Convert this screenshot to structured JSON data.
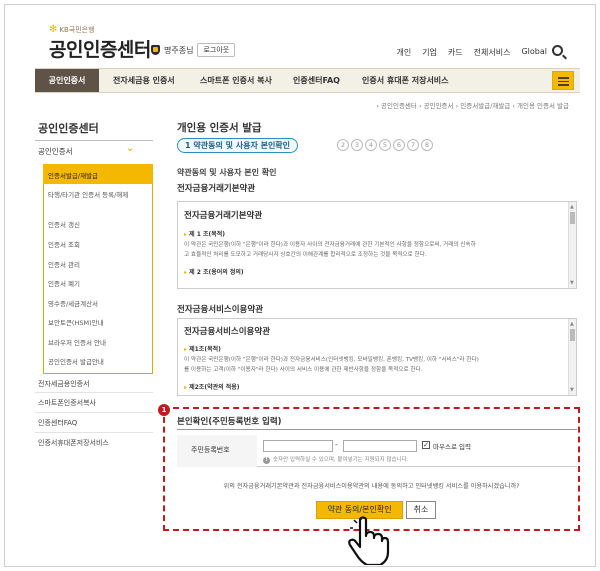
{
  "header": {
    "bank_name": "KB국민은행",
    "title": "공인인증센터",
    "user_name": "명주종님",
    "logout_label": "로그아웃",
    "nav": [
      "개인",
      "기업",
      "카드",
      "전체서비스",
      "Global"
    ]
  },
  "gnb": {
    "items": [
      "공인인증서",
      "전자세금용 인증서",
      "스마트폰 인증서 복사",
      "인증센터FAQ",
      "인증서 휴대폰 저장서비스"
    ],
    "active": "공인인증서"
  },
  "breadcrumb": "› 공인인증센터 › 공인인증서 › 인증서발급/재발급 › 개인용 인증서 발급",
  "sidebar": {
    "title": "공인인증센터",
    "header": "공인인증서",
    "subitems": [
      "인증서발급/재발급",
      "타행/타기관 인증서 등록/해제",
      "인증서 갱신",
      "인증서 조회",
      "인증서 관리",
      "인증서 폐기",
      "영수증/세금계산서",
      "보안토큰(HSM)안내",
      "브라우저 인증서 안내",
      "공인인증서 발급안내"
    ],
    "menus": [
      "전자세금용인증서",
      "스마트폰인증서복사",
      "인증센터FAQ",
      "인증서휴대폰저장서비스"
    ]
  },
  "main": {
    "title": "개인용 인증서 발급",
    "step_current": "1 약관동의 및 사용자 본인확인",
    "steps": [
      "2",
      "3",
      "4",
      "5",
      "6",
      "7",
      "8"
    ],
    "section_heading": "약관동의 및 사용자 본인 확인",
    "terms1": {
      "heading": "전자금융거래기본약관",
      "box_title": "전자금융거래기본약관",
      "article1": "제 1 조(목적)",
      "text1a": "이 약관은 국민은행(이하 \"은행\"이라 한다)과 이용자 사이의 전자금융거래에 관한 기본적인 사항을 정함으로써, 거래의 신속하",
      "text1b": "고 효율적인 처리를 도모하고 거래당사자 상호간의 이해관계를 합리적으로 조정하는 것을 목적으로 한다.",
      "article2": "제 2 조(용어의 정의)"
    },
    "terms2": {
      "heading": "전자금융서비스이용약관",
      "box_title": "전자금융서비스이용약관",
      "article1": "제1조(목적)",
      "text1a": "이 약관은 국민은행(이하 \"은행\"이라 한다)과 전자금융서비스(인터넷뱅킹, 모바일뱅킹, 폰뱅킹, TV뱅킹, 이하 \"서비스\"라 한다)",
      "text1b": "를 이용하는 고객(이하 \"이용자\"라 한다) 사이의 서비스 이용에 관한 제반사항을 정함을 목적으로 한다.",
      "article2": "제2조(약관의 적용)"
    },
    "verify": {
      "badge": "1",
      "title": "본인확인(주민등록번호 입력)",
      "rrn_label": "주민등록번호",
      "masking_label": "마우스로 입력",
      "hint": "숫자만 입력하실 수 있으며, 붙여넣기는 지원되지 않습니다.",
      "agree_text": "위의 전자금융거래기본약관과 전자금융서비스이용약관의 내용에 동의하고 인터넷뱅킹 서비스를 이용하시겠습니까?",
      "ok_label": "약관 동의/본인확인",
      "cancel_label": "취소"
    }
  },
  "colors": {
    "accent": "#f5b800",
    "gnb_active": "#5e5346",
    "highlight": "#c0191f",
    "step": "#2d8fbf"
  },
  "icons": [
    "star-icon",
    "shield-icon",
    "search-icon",
    "menu-icon",
    "chevron-down-icon",
    "pointer-hand-icon"
  ]
}
